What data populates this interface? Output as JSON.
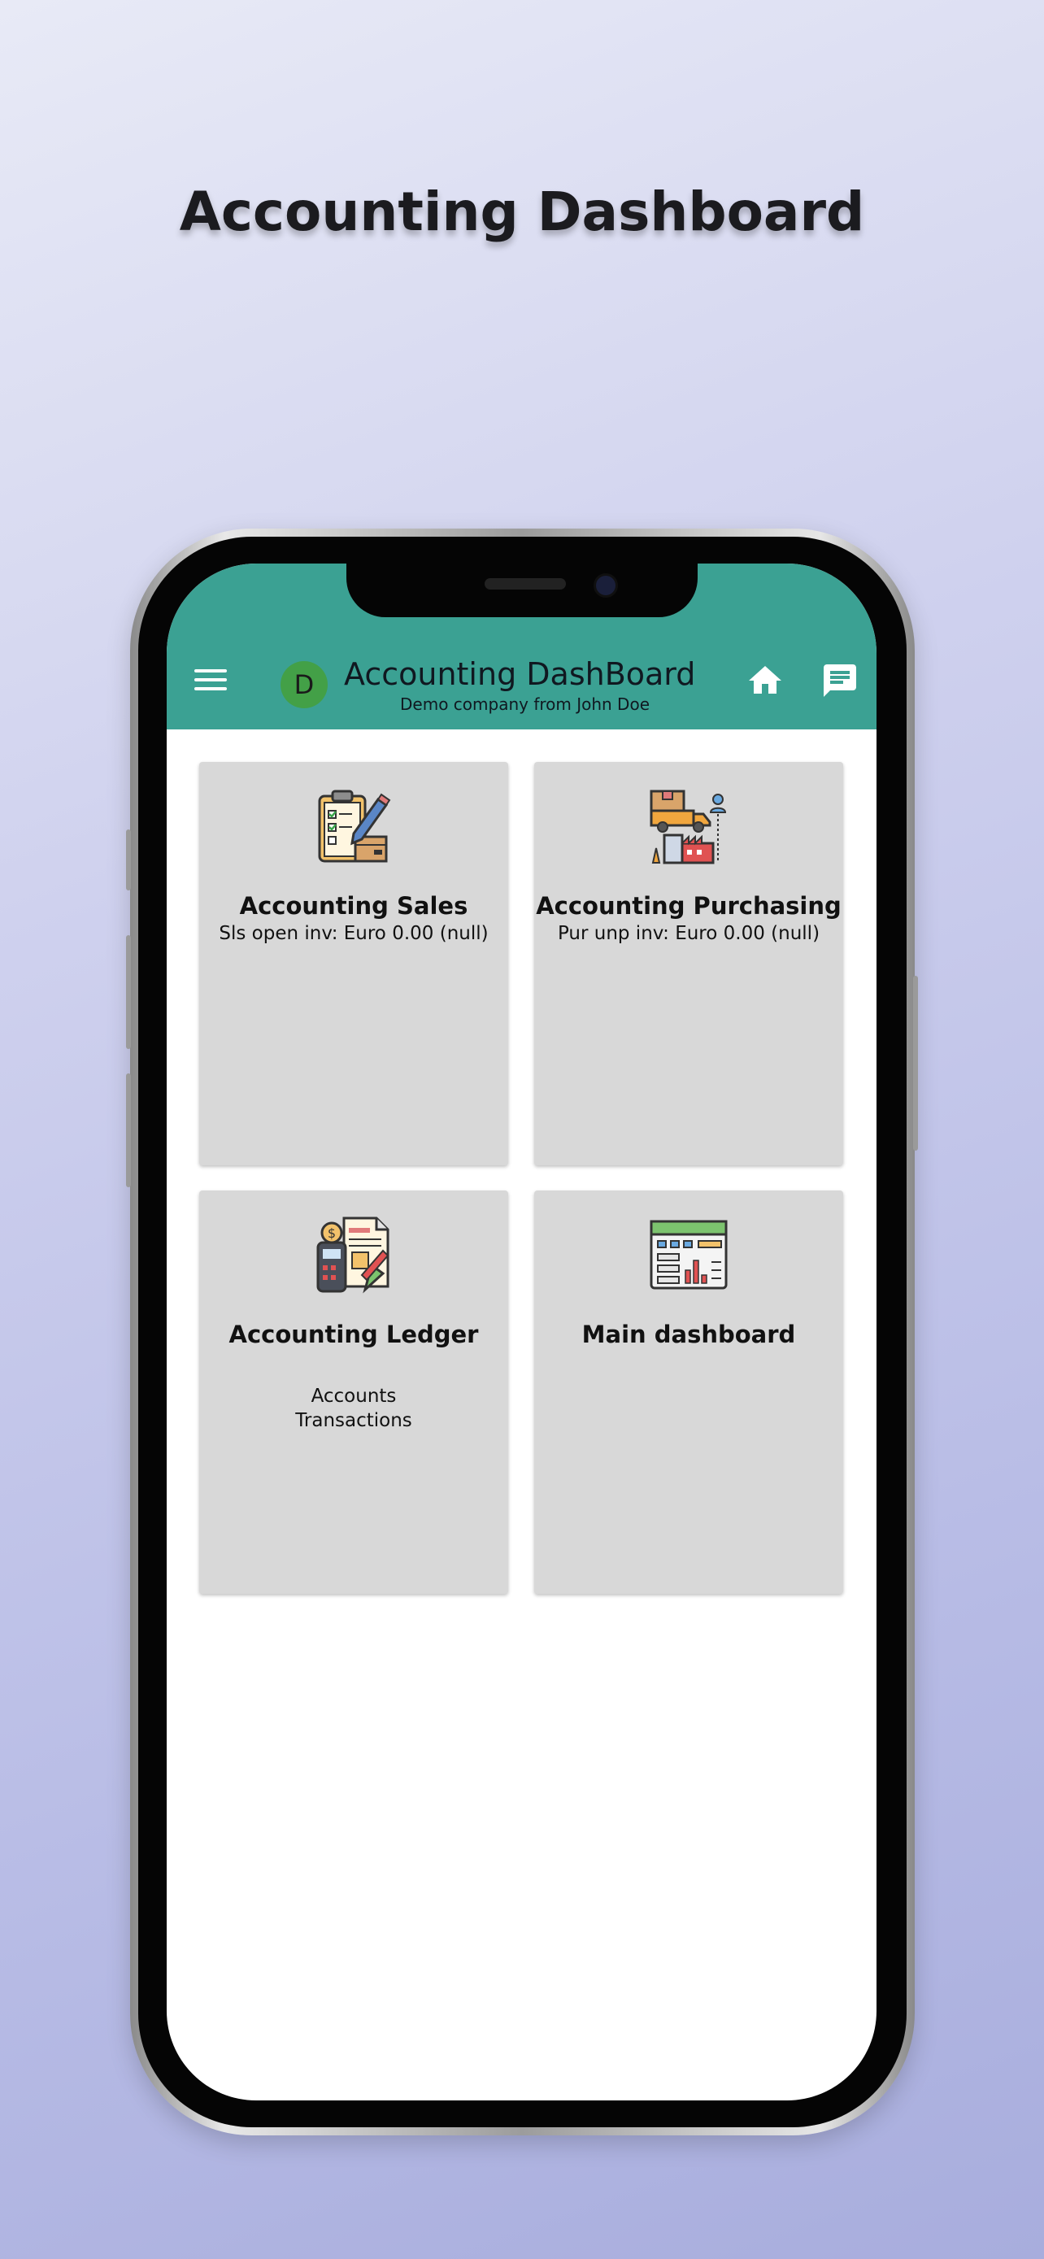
{
  "headline": "Accounting Dashboard",
  "colors": {
    "appbar": "#3ba193",
    "avatar": "#43a047",
    "card_bg": "#d8d8d8"
  },
  "appbar": {
    "menu_icon": "hamburger-menu-icon",
    "avatar_letter": "D",
    "title": "Accounting DashBoard",
    "subtitle": "Demo company from John Doe",
    "home_icon": "home-icon",
    "chat_icon": "chat-icon"
  },
  "cards": [
    {
      "title": "Accounting Sales",
      "subtitle": "Sls open inv: Euro 0.00 (null)",
      "icon": "clipboard-checklist-icon"
    },
    {
      "title": "Accounting Purchasing",
      "subtitle": "Pur unp inv: Euro 0.00 (null)",
      "icon": "delivery-truck-factory-icon"
    },
    {
      "title": "Accounting Ledger",
      "lines": [
        "Accounts",
        "Transactions"
      ],
      "icon": "ledger-calculator-icon"
    },
    {
      "title": "Main dashboard",
      "icon": "dashboard-chart-icon"
    }
  ]
}
